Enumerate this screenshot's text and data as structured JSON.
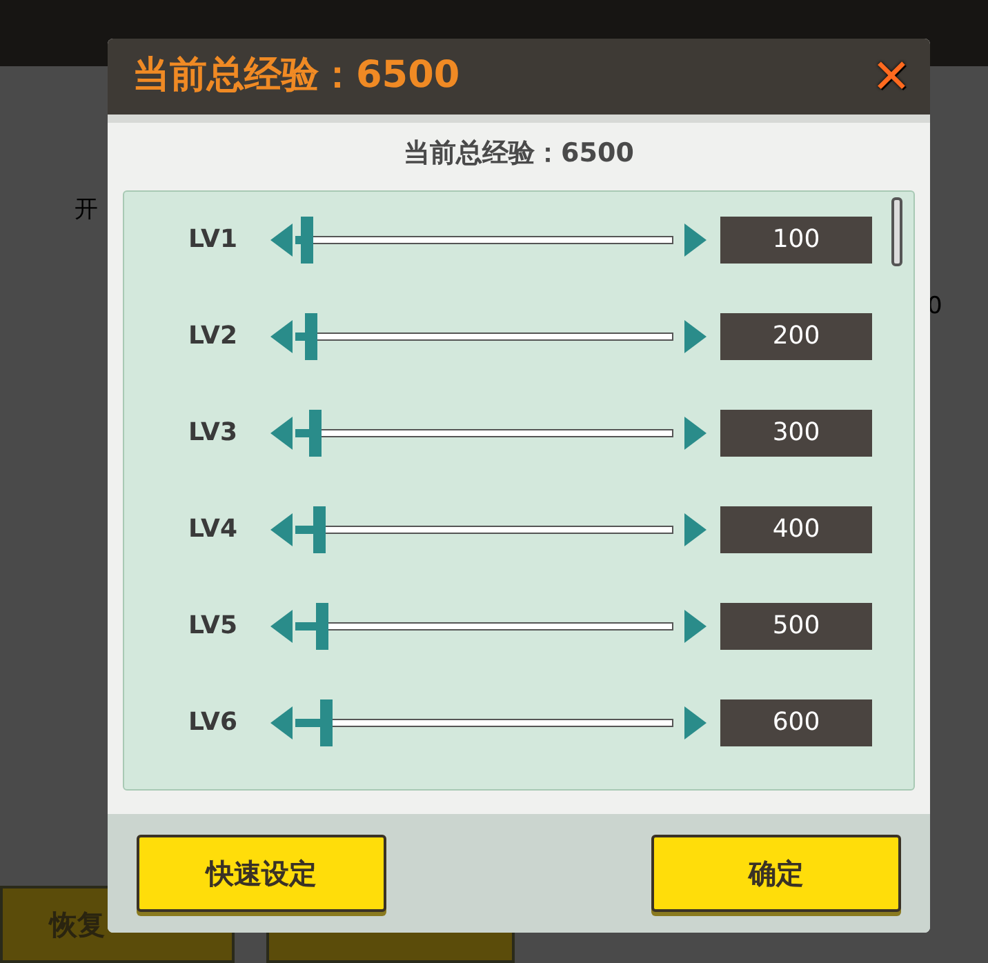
{
  "background": {
    "texts": [
      "开",
      "0"
    ],
    "buttons": [
      "恢复"
    ]
  },
  "dialog": {
    "title": "当前总经验：6500",
    "close": "✕",
    "summary": "当前总经验：6500",
    "levels": [
      {
        "label": "LV1",
        "level": 0.02,
        "value": "100"
      },
      {
        "label": "LV2",
        "level": 0.03,
        "value": "200"
      },
      {
        "label": "LV3",
        "level": 0.04,
        "value": "300"
      },
      {
        "label": "LV4",
        "level": 0.05,
        "value": "400"
      },
      {
        "label": "LV5",
        "level": 0.06,
        "value": "500"
      },
      {
        "label": "LV6",
        "level": 0.07,
        "value": "600"
      }
    ],
    "buttons": [
      "快速设定",
      "确定"
    ]
  }
}
